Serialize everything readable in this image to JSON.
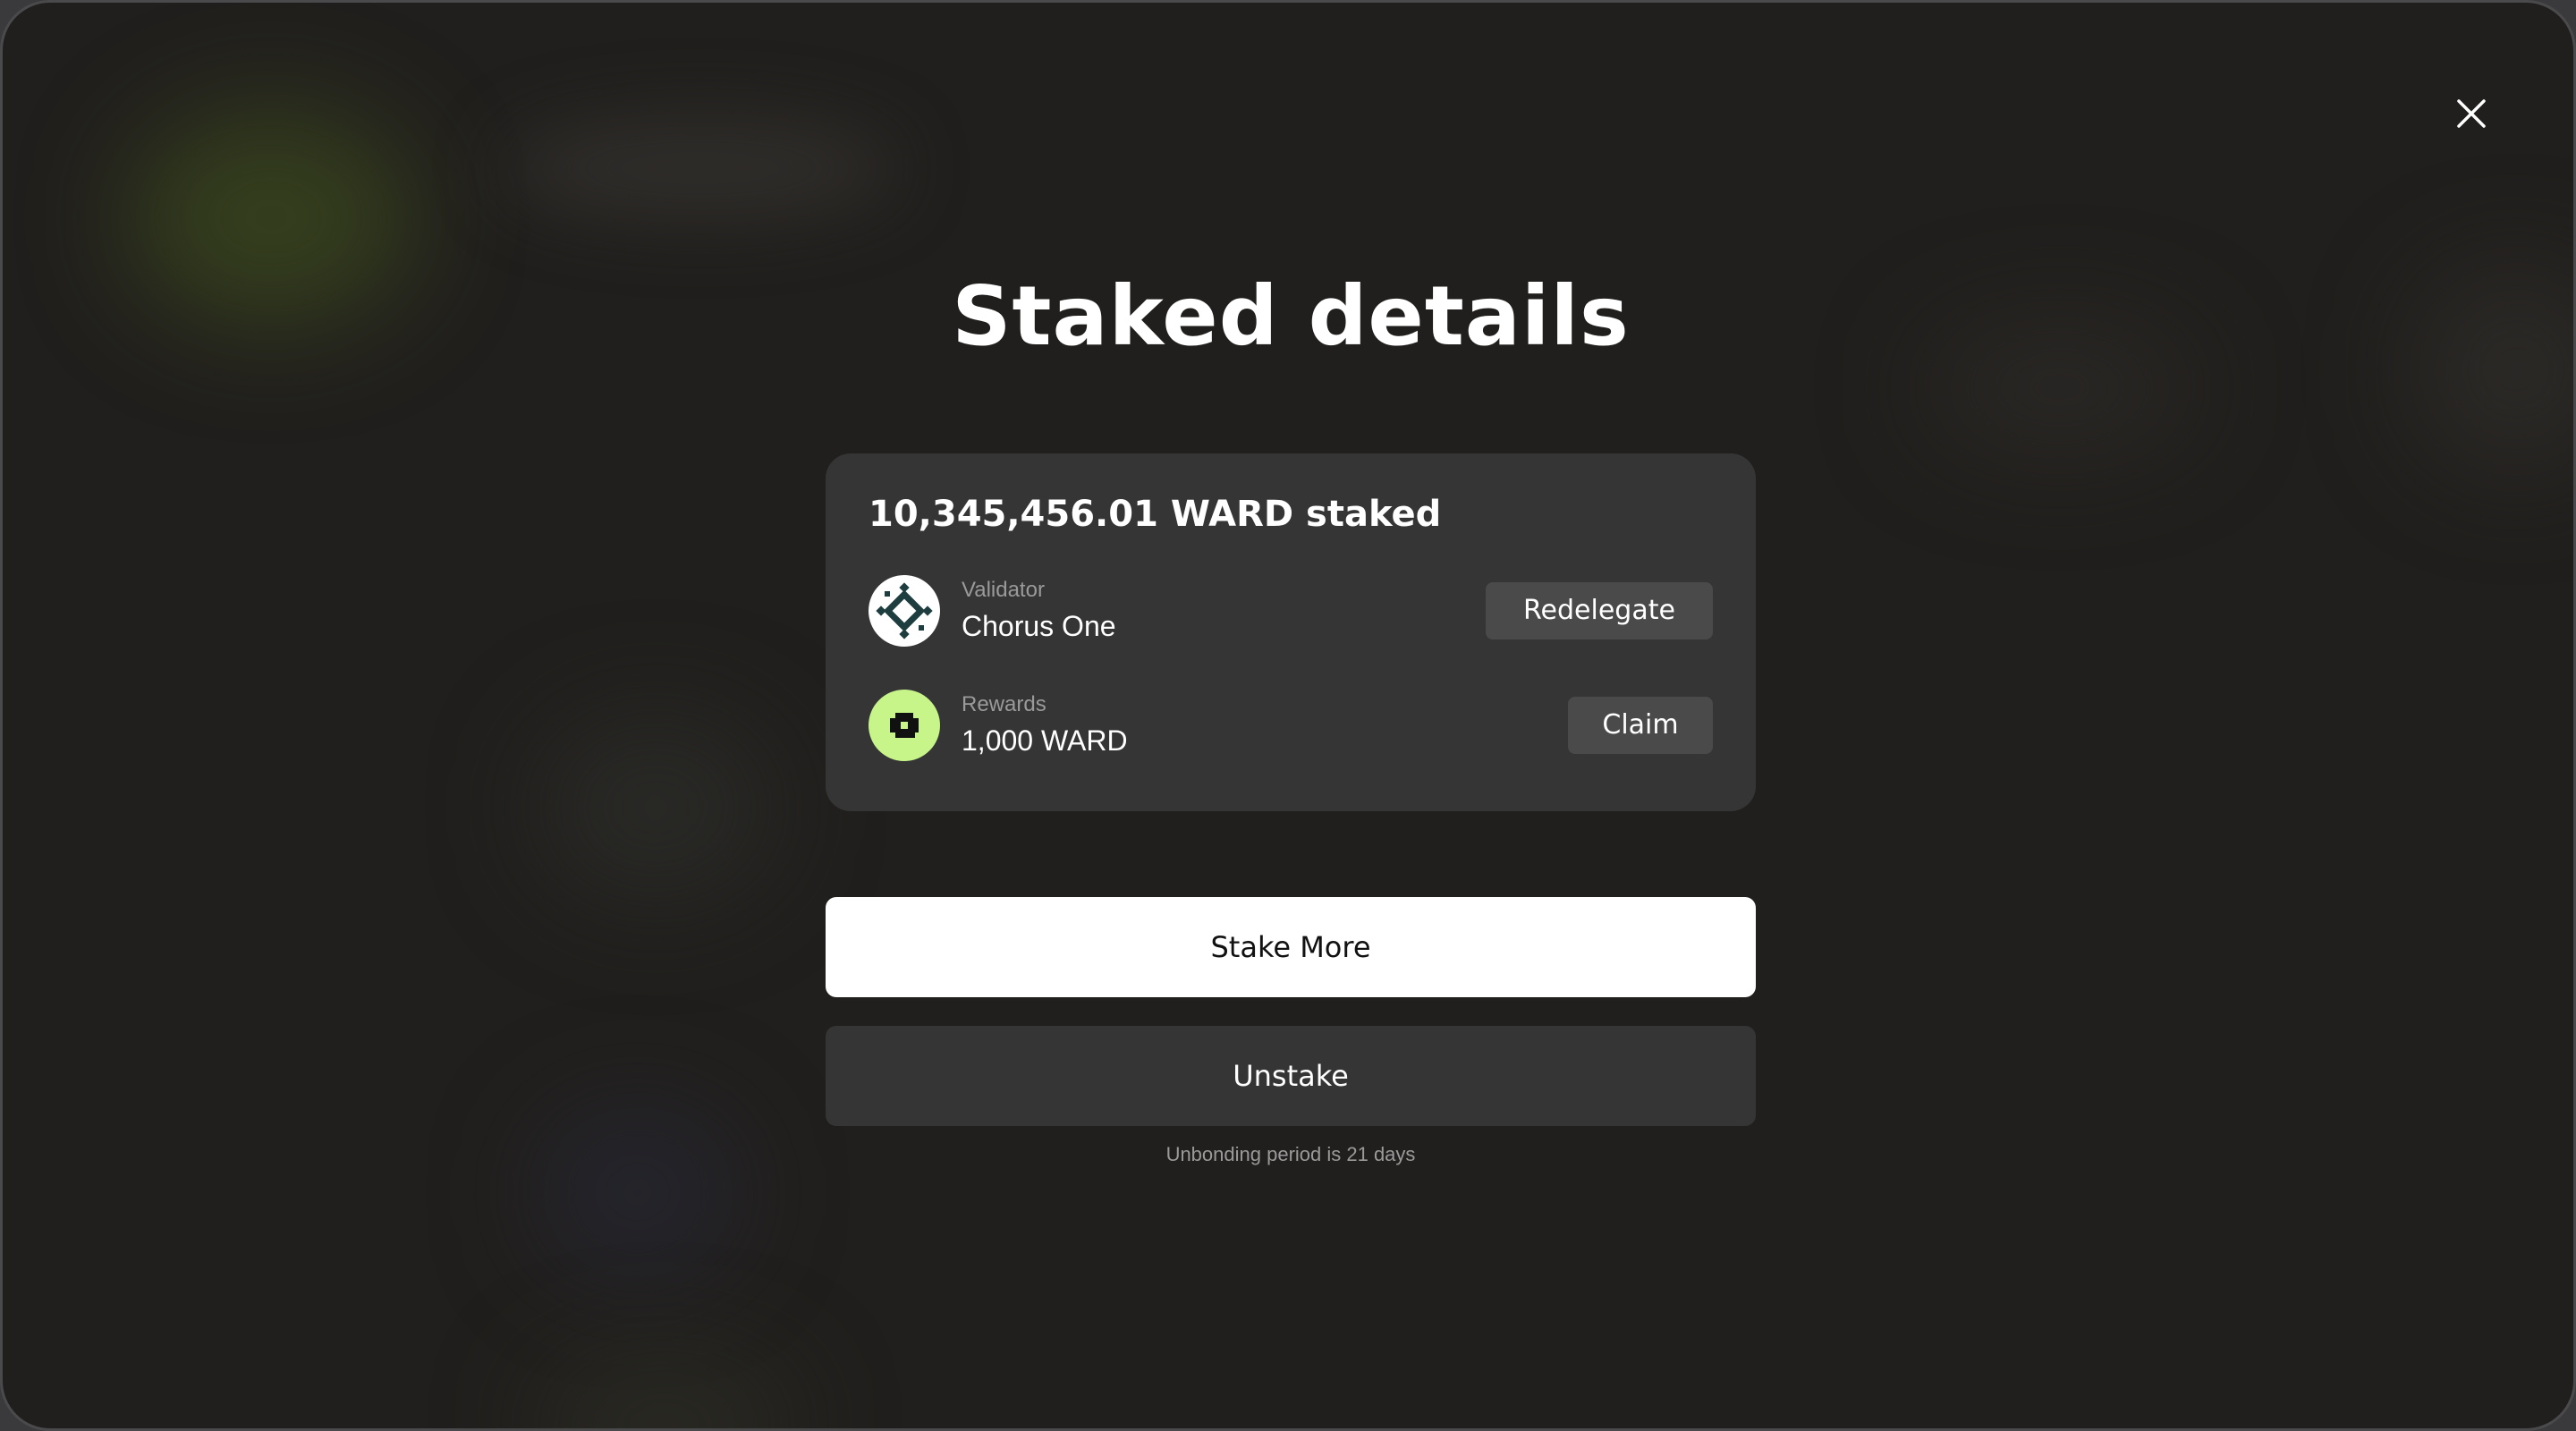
{
  "modal": {
    "title": "Staked details",
    "close_icon": "close-icon"
  },
  "summary": {
    "staked_amount": "10,345,456.01 WARD staked",
    "validator": {
      "label": "Validator",
      "value": "Chorus One",
      "icon": "chorus-one-logo-icon",
      "action_label": "Redelegate"
    },
    "rewards": {
      "label": "Rewards",
      "value": "1,000 WARD",
      "icon": "ward-token-icon",
      "action_label": "Claim"
    }
  },
  "actions": {
    "stake_more_label": "Stake More",
    "unstake_label": "Unstake",
    "unbonding_note": "Unbonding period is 21 days"
  },
  "colors": {
    "background": "#211f1d",
    "card": "#353535",
    "button_secondary": "#4a4a4a",
    "primary_button": "#ffffff",
    "rewards_accent": "#c8f58a",
    "validator_logo": "#1e3d3f",
    "muted_text": "#9a9a9a"
  }
}
